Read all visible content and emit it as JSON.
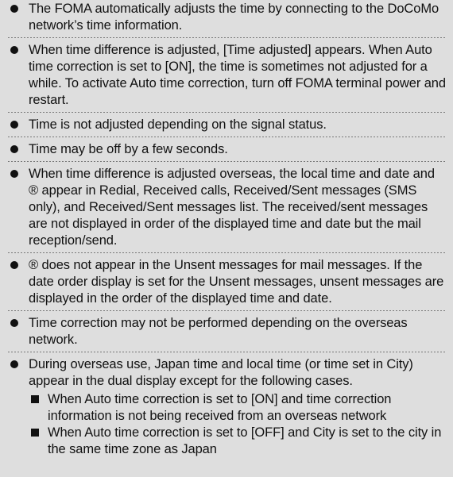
{
  "items": [
    {
      "text": "The FOMA automatically adjusts the time by connecting to the DoCoMo network’s time information."
    },
    {
      "text": "When time difference is adjusted, [Time adjusted] appears. When Auto time correction is set to [ON], the time is sometimes not adjusted for a while. To activate Auto time correction, turn off FOMA terminal power and restart."
    },
    {
      "text": "Time is not adjusted depending on the signal status."
    },
    {
      "text": "Time may be off by a few seconds."
    },
    {
      "text": "When time difference is adjusted overseas, the local time and date and ® appear in Redial, Received calls, Received/Sent messages (SMS only), and Received/Sent messages list. The received/sent messages are not displayed in order of the displayed time and date but the mail reception/send."
    },
    {
      "text": "® does not appear in the Unsent messages for mail messages. If the date order display is set for the Unsent messages, unsent messages are displayed in the order of the displayed time and date."
    },
    {
      "text": "Time correction may not be performed depending on the overseas network."
    },
    {
      "text": "During overseas use, Japan time and local time (or time set in City) appear in the dual display except for the following cases.",
      "subitems": [
        "When Auto time correction is set to [ON] and time correction information is not being received from an overseas network",
        "When Auto time correction is set to [OFF] and City is set to the city in the same time zone as Japan"
      ]
    }
  ]
}
